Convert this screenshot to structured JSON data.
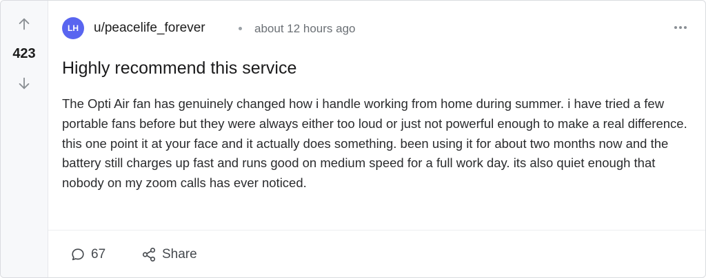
{
  "post": {
    "votes": "423",
    "author": {
      "avatar_initials": "LH",
      "username": "u/peacelife_forever",
      "timestamp": "about 12 hours ago"
    },
    "title": "Highly recommend this service",
    "body": "The Opti Air fan has genuinely changed how i handle working from home during summer. i have tried a few portable fans before but they were always either too loud or just not powerful enough to make a real difference. this one point it at your face and it actually does something. been using it for about two months now and the battery still charges up fast and runs good on medium speed for a full work day. its also quiet enough that nobody on my zoom calls has ever noticed."
  },
  "actions": {
    "comment_count": "67",
    "share_label": "Share"
  },
  "icons": {
    "upvote": "arrow-up-icon",
    "downvote": "arrow-down-icon",
    "more": "more-horizontal-icon",
    "comment": "comment-bubble-icon",
    "share": "share-nodes-icon"
  },
  "colors": {
    "avatar_bg": "#5965f0",
    "vote_column_bg": "#f7f8fa",
    "border": "#d9dbdf",
    "muted_text": "#6b7075"
  }
}
